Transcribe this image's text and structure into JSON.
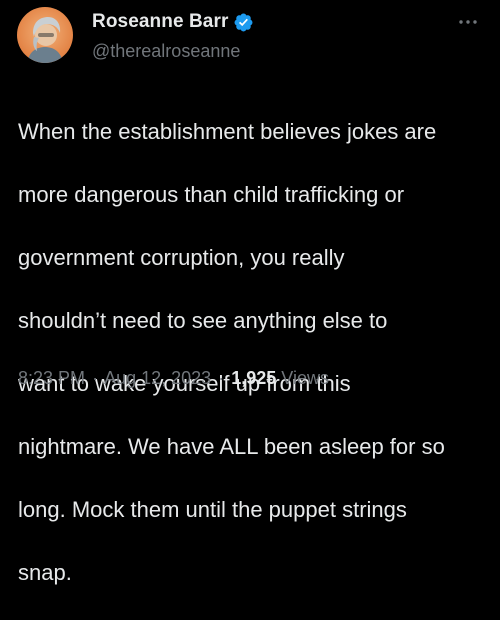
{
  "author": {
    "display_name": "Roseanne Barr",
    "handle": "@therealroseanne",
    "verified": true,
    "avatar_icon": "profile-avatar-icon"
  },
  "icons": {
    "verified": "verified-badge-icon",
    "more": "more-options-icon"
  },
  "colors": {
    "background": "#000000",
    "text_primary": "#e7e9ea",
    "text_secondary": "#71767b",
    "verified_blue": "#1d9bf0"
  },
  "tweet": {
    "text_lines": [
      "When the establishment believes jokes are",
      "more dangerous than child trafficking or",
      "government corruption, you really",
      "shouldn’t need to see anything else to",
      "want to wake yourself up from this",
      "nightmare. We have ALL been asleep for so",
      "long. Mock them until the puppet strings",
      "snap."
    ]
  },
  "meta": {
    "time": "8:23 PM",
    "separator": "·",
    "date": "Aug 12, 2023",
    "views_count": "1,925",
    "views_label": "Views"
  }
}
